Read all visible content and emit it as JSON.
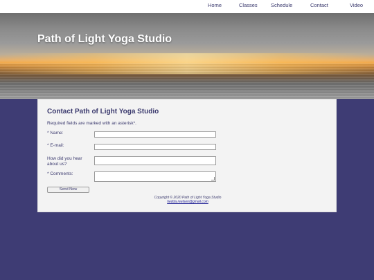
{
  "nav": {
    "items": [
      "Home",
      "Classes",
      "Schedule",
      "Contact",
      "Video"
    ]
  },
  "hero": {
    "title": "Path of Light Yoga Studio"
  },
  "form": {
    "heading": "Contact Path of Light Yoga Studio",
    "required_note": "Required fields are marked with an asterisk*.",
    "name_label": "* Name:",
    "email_label": "* E-mail:",
    "hear_label": "How did you hear about us?",
    "comments_label": "* Comments:",
    "name_value": "",
    "email_value": "",
    "hear_value": "",
    "comments_value": "",
    "submit_label": "Send Now"
  },
  "footer": {
    "copyright": "Copyright © 2020 Path of Light Yoga Studio",
    "email": "hedda.reelsen@gmail.com"
  },
  "colors": {
    "page_background": "#3e3c74",
    "text": "#3b3a6e",
    "card_background": "#f3f3f3"
  }
}
